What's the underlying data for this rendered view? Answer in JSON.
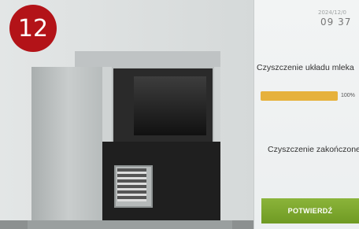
{
  "step": {
    "number": "12"
  },
  "header": {
    "date": "2024/12/0",
    "time": "09 37"
  },
  "process": {
    "milk_title": "Czyszczenie układu mleka",
    "progress_text": "100%",
    "progress_value": 1.0
  },
  "status": {
    "done_title": "Czyszczenie zakończone"
  },
  "actions": {
    "confirm_label": "POTWIERDŹ"
  },
  "colors": {
    "badge": "#b31318",
    "progress": "#e6b13c",
    "confirm": "#7aa52c"
  }
}
